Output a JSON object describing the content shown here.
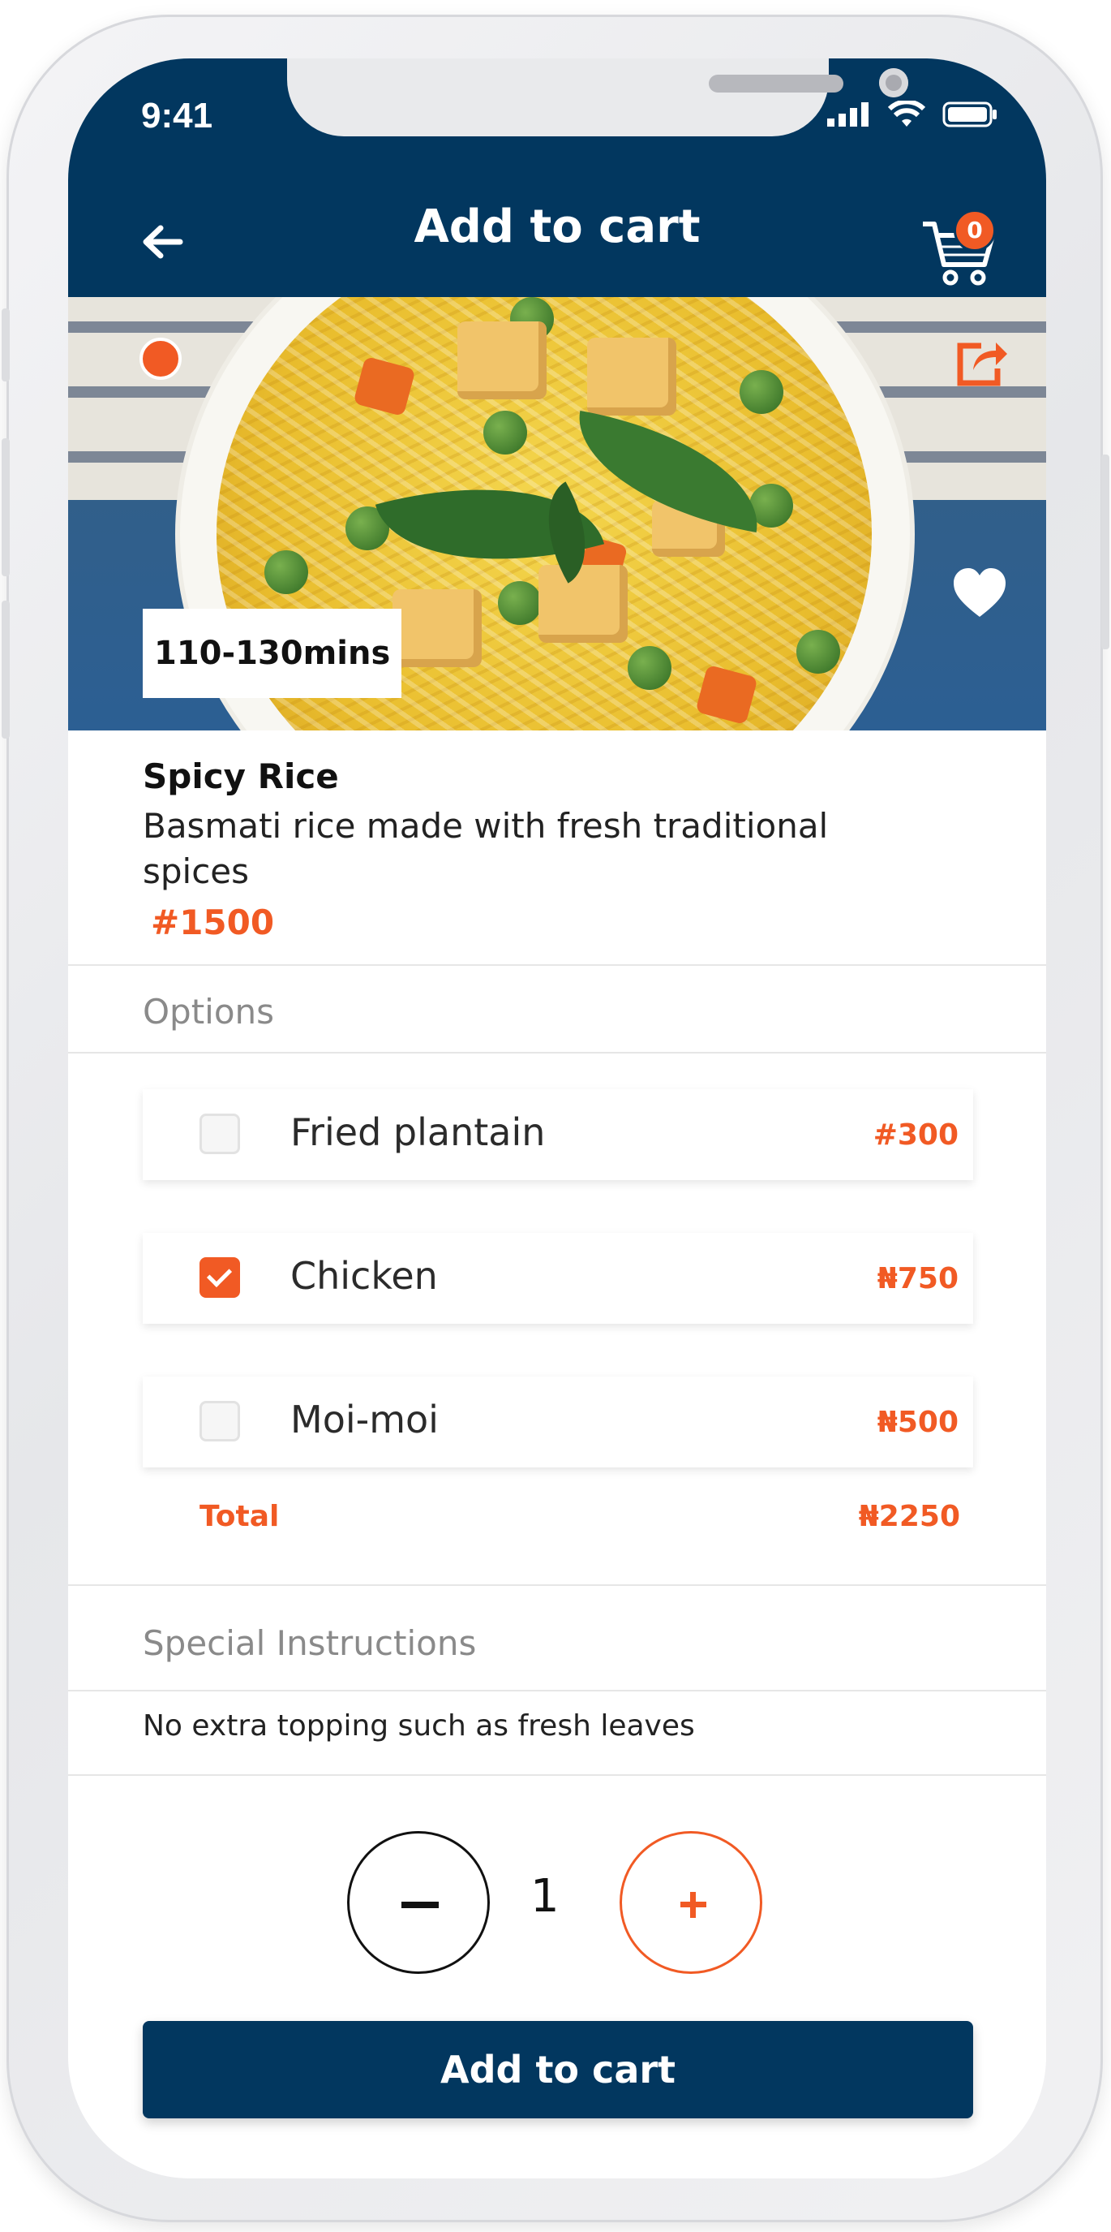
{
  "status_bar": {
    "time": "9:41"
  },
  "header": {
    "title": "Add to cart",
    "cart_count": "0"
  },
  "hero": {
    "prep_time": "110-130mins"
  },
  "item": {
    "name": "Spicy Rice",
    "description": "Basmati rice made with fresh traditional\n spices",
    "price": "#1500"
  },
  "options": {
    "section_label": "Options",
    "items": [
      {
        "label": "Fried plantain",
        "price": "#300",
        "checked": false
      },
      {
        "label": "Chicken",
        "price": "₦750",
        "checked": true
      },
      {
        "label": "Moi-moi",
        "price": "₦500",
        "checked": false
      }
    ],
    "total_label": "Total",
    "total_value": "₦2250"
  },
  "special_instructions": {
    "section_label": "Special Instructions",
    "text": "No extra topping such as fresh leaves"
  },
  "quantity": {
    "value": "1"
  },
  "add_button": {
    "label": "Add to cart"
  },
  "colors": {
    "primary": "#02375f",
    "accent": "#f15a24"
  },
  "icons": [
    "back-arrow-icon",
    "cart-icon",
    "share-icon",
    "heart-icon",
    "signal-icon",
    "wifi-icon",
    "battery-icon",
    "checkmark-icon",
    "minus-icon",
    "plus-icon"
  ]
}
